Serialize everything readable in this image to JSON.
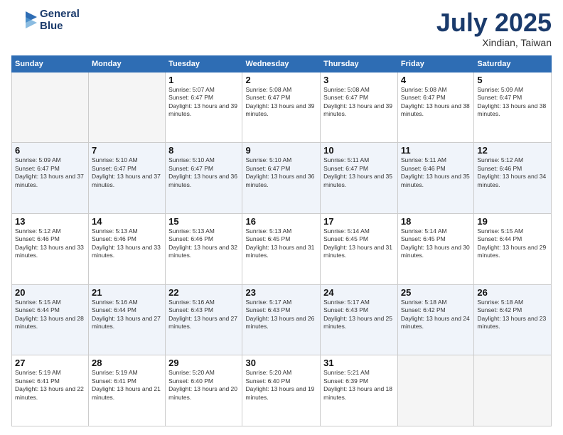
{
  "logo": {
    "line1": "General",
    "line2": "Blue"
  },
  "title": "July 2025",
  "subtitle": "Xindian, Taiwan",
  "days_of_week": [
    "Sunday",
    "Monday",
    "Tuesday",
    "Wednesday",
    "Thursday",
    "Friday",
    "Saturday"
  ],
  "weeks": [
    [
      {
        "day": "",
        "info": ""
      },
      {
        "day": "",
        "info": ""
      },
      {
        "day": "1",
        "info": "Sunrise: 5:07 AM\nSunset: 6:47 PM\nDaylight: 13 hours and 39 minutes."
      },
      {
        "day": "2",
        "info": "Sunrise: 5:08 AM\nSunset: 6:47 PM\nDaylight: 13 hours and 39 minutes."
      },
      {
        "day": "3",
        "info": "Sunrise: 5:08 AM\nSunset: 6:47 PM\nDaylight: 13 hours and 39 minutes."
      },
      {
        "day": "4",
        "info": "Sunrise: 5:08 AM\nSunset: 6:47 PM\nDaylight: 13 hours and 38 minutes."
      },
      {
        "day": "5",
        "info": "Sunrise: 5:09 AM\nSunset: 6:47 PM\nDaylight: 13 hours and 38 minutes."
      }
    ],
    [
      {
        "day": "6",
        "info": "Sunrise: 5:09 AM\nSunset: 6:47 PM\nDaylight: 13 hours and 37 minutes."
      },
      {
        "day": "7",
        "info": "Sunrise: 5:10 AM\nSunset: 6:47 PM\nDaylight: 13 hours and 37 minutes."
      },
      {
        "day": "8",
        "info": "Sunrise: 5:10 AM\nSunset: 6:47 PM\nDaylight: 13 hours and 36 minutes."
      },
      {
        "day": "9",
        "info": "Sunrise: 5:10 AM\nSunset: 6:47 PM\nDaylight: 13 hours and 36 minutes."
      },
      {
        "day": "10",
        "info": "Sunrise: 5:11 AM\nSunset: 6:47 PM\nDaylight: 13 hours and 35 minutes."
      },
      {
        "day": "11",
        "info": "Sunrise: 5:11 AM\nSunset: 6:46 PM\nDaylight: 13 hours and 35 minutes."
      },
      {
        "day": "12",
        "info": "Sunrise: 5:12 AM\nSunset: 6:46 PM\nDaylight: 13 hours and 34 minutes."
      }
    ],
    [
      {
        "day": "13",
        "info": "Sunrise: 5:12 AM\nSunset: 6:46 PM\nDaylight: 13 hours and 33 minutes."
      },
      {
        "day": "14",
        "info": "Sunrise: 5:13 AM\nSunset: 6:46 PM\nDaylight: 13 hours and 33 minutes."
      },
      {
        "day": "15",
        "info": "Sunrise: 5:13 AM\nSunset: 6:46 PM\nDaylight: 13 hours and 32 minutes."
      },
      {
        "day": "16",
        "info": "Sunrise: 5:13 AM\nSunset: 6:45 PM\nDaylight: 13 hours and 31 minutes."
      },
      {
        "day": "17",
        "info": "Sunrise: 5:14 AM\nSunset: 6:45 PM\nDaylight: 13 hours and 31 minutes."
      },
      {
        "day": "18",
        "info": "Sunrise: 5:14 AM\nSunset: 6:45 PM\nDaylight: 13 hours and 30 minutes."
      },
      {
        "day": "19",
        "info": "Sunrise: 5:15 AM\nSunset: 6:44 PM\nDaylight: 13 hours and 29 minutes."
      }
    ],
    [
      {
        "day": "20",
        "info": "Sunrise: 5:15 AM\nSunset: 6:44 PM\nDaylight: 13 hours and 28 minutes."
      },
      {
        "day": "21",
        "info": "Sunrise: 5:16 AM\nSunset: 6:44 PM\nDaylight: 13 hours and 27 minutes."
      },
      {
        "day": "22",
        "info": "Sunrise: 5:16 AM\nSunset: 6:43 PM\nDaylight: 13 hours and 27 minutes."
      },
      {
        "day": "23",
        "info": "Sunrise: 5:17 AM\nSunset: 6:43 PM\nDaylight: 13 hours and 26 minutes."
      },
      {
        "day": "24",
        "info": "Sunrise: 5:17 AM\nSunset: 6:43 PM\nDaylight: 13 hours and 25 minutes."
      },
      {
        "day": "25",
        "info": "Sunrise: 5:18 AM\nSunset: 6:42 PM\nDaylight: 13 hours and 24 minutes."
      },
      {
        "day": "26",
        "info": "Sunrise: 5:18 AM\nSunset: 6:42 PM\nDaylight: 13 hours and 23 minutes."
      }
    ],
    [
      {
        "day": "27",
        "info": "Sunrise: 5:19 AM\nSunset: 6:41 PM\nDaylight: 13 hours and 22 minutes."
      },
      {
        "day": "28",
        "info": "Sunrise: 5:19 AM\nSunset: 6:41 PM\nDaylight: 13 hours and 21 minutes."
      },
      {
        "day": "29",
        "info": "Sunrise: 5:20 AM\nSunset: 6:40 PM\nDaylight: 13 hours and 20 minutes."
      },
      {
        "day": "30",
        "info": "Sunrise: 5:20 AM\nSunset: 6:40 PM\nDaylight: 13 hours and 19 minutes."
      },
      {
        "day": "31",
        "info": "Sunrise: 5:21 AM\nSunset: 6:39 PM\nDaylight: 13 hours and 18 minutes."
      },
      {
        "day": "",
        "info": ""
      },
      {
        "day": "",
        "info": ""
      }
    ]
  ]
}
